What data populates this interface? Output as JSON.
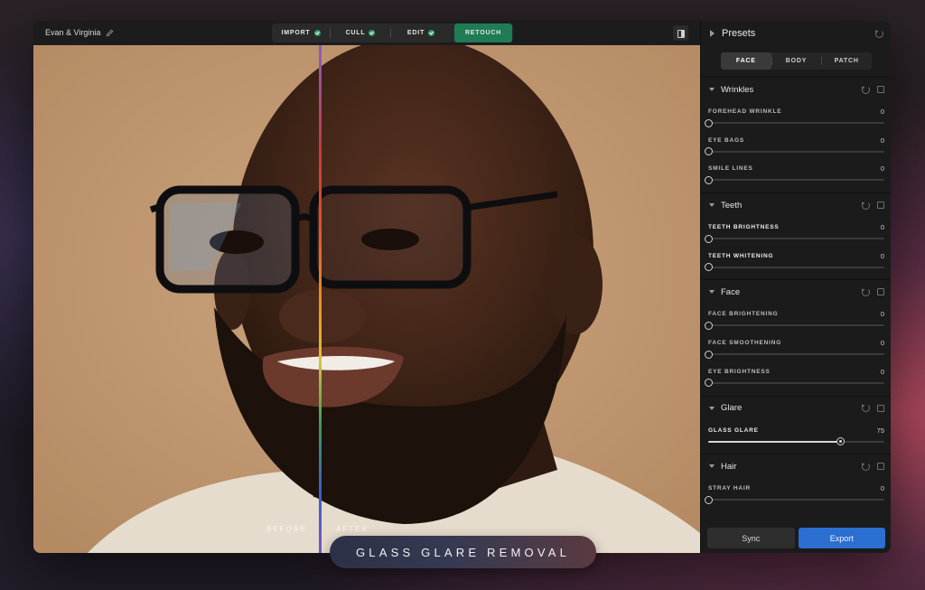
{
  "project": {
    "name": "Evan & Virginia"
  },
  "workflow": {
    "steps": [
      {
        "label": "IMPORT",
        "done": true
      },
      {
        "label": "CULL",
        "done": true
      },
      {
        "label": "EDIT",
        "done": true
      },
      {
        "label": "RETOUCH",
        "active": true
      }
    ]
  },
  "viewer": {
    "before_label": "BEFORE",
    "after_label": "AFTER",
    "split_colors": "rainbow"
  },
  "sidebar": {
    "title": "Presets",
    "tabs": [
      {
        "label": "FACE",
        "active": true
      },
      {
        "label": "BODY"
      },
      {
        "label": "PATCH"
      }
    ],
    "sections": [
      {
        "title": "Wrinkles",
        "sliders": [
          {
            "label": "FOREHEAD WRINKLE",
            "value": "0"
          },
          {
            "label": "EYE BAGS",
            "value": "0"
          },
          {
            "label": "SMILE LINES",
            "value": "0"
          }
        ]
      },
      {
        "title": "Teeth",
        "sliders": [
          {
            "label": "TEETH BRIGHTNESS",
            "value": "0"
          },
          {
            "label": "TEETH WHITENING",
            "value": "0"
          }
        ]
      },
      {
        "title": "Face",
        "sliders": [
          {
            "label": "FACE BRIGHTENING",
            "value": "0"
          },
          {
            "label": "FACE SMOOTHENING",
            "value": "0"
          },
          {
            "label": "EYE BRIGHTNESS",
            "value": "0"
          }
        ]
      },
      {
        "title": "Glare",
        "sliders": [
          {
            "label": "GLASS GLARE",
            "value": "75"
          }
        ]
      },
      {
        "title": "Hair",
        "sliders": [
          {
            "label": "STRAY HAIR",
            "value": "0"
          }
        ]
      }
    ],
    "sync_label": "Sync",
    "export_label": "Export",
    "accent": "#2b6fd1",
    "active_step_color": "#1f7c55"
  },
  "caption": "GLASS GLARE REMOVAL"
}
